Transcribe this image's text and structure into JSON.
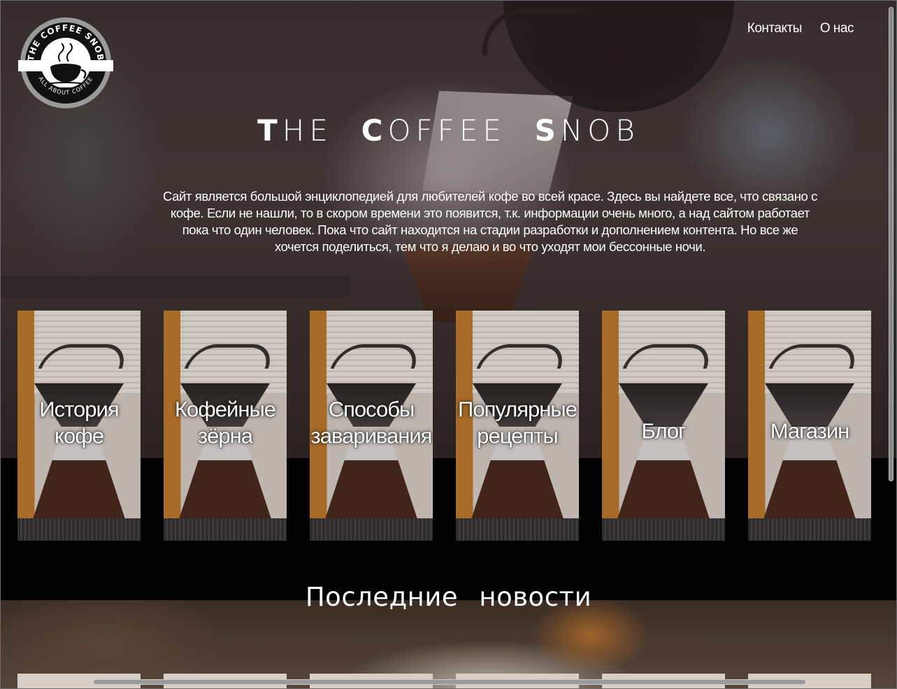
{
  "header": {
    "logo": {
      "top_text": "THE COFFEE SNOB",
      "bottom_text": "ALL ABOUT COFFEE"
    },
    "nav": [
      "Контакты",
      "О нас"
    ]
  },
  "hero": {
    "title": {
      "part1_initial": "T",
      "part1_rest": "HE",
      "part2_initial": "C",
      "part2_rest": "OFFEE",
      "part3_initial": "S",
      "part3_rest": "NOB"
    },
    "intro": "Сайт является большой энциклопедией для любителей кофе во всей красе. Здесь вы найдете все, что связано с кофе. Если не нашли, то в скором времени это появится, т.к. информации очень много, а над сайтом работает пока что один человек. Пока что сайт находится на стадии разработки и дополнением контента. Но все же хочется поделиться, тем что я делаю и во что уходят мои бессонные ночи."
  },
  "categories": [
    {
      "line1": "История",
      "line2": "кофе"
    },
    {
      "line1": "Кофейные",
      "line2": "зёрна"
    },
    {
      "line1": "Способы",
      "line2": "заваривания"
    },
    {
      "line1": "Популярные",
      "line2": "рецепты"
    },
    {
      "line1": "Блог",
      "line2": ""
    },
    {
      "line1": "Магазин",
      "line2": ""
    }
  ],
  "news": {
    "title": "Последние новости"
  },
  "colors": {
    "background": "#000000",
    "text": "#ffffff",
    "card_wall": "#d9cfc8",
    "card_curtain": "#c07a2e"
  }
}
